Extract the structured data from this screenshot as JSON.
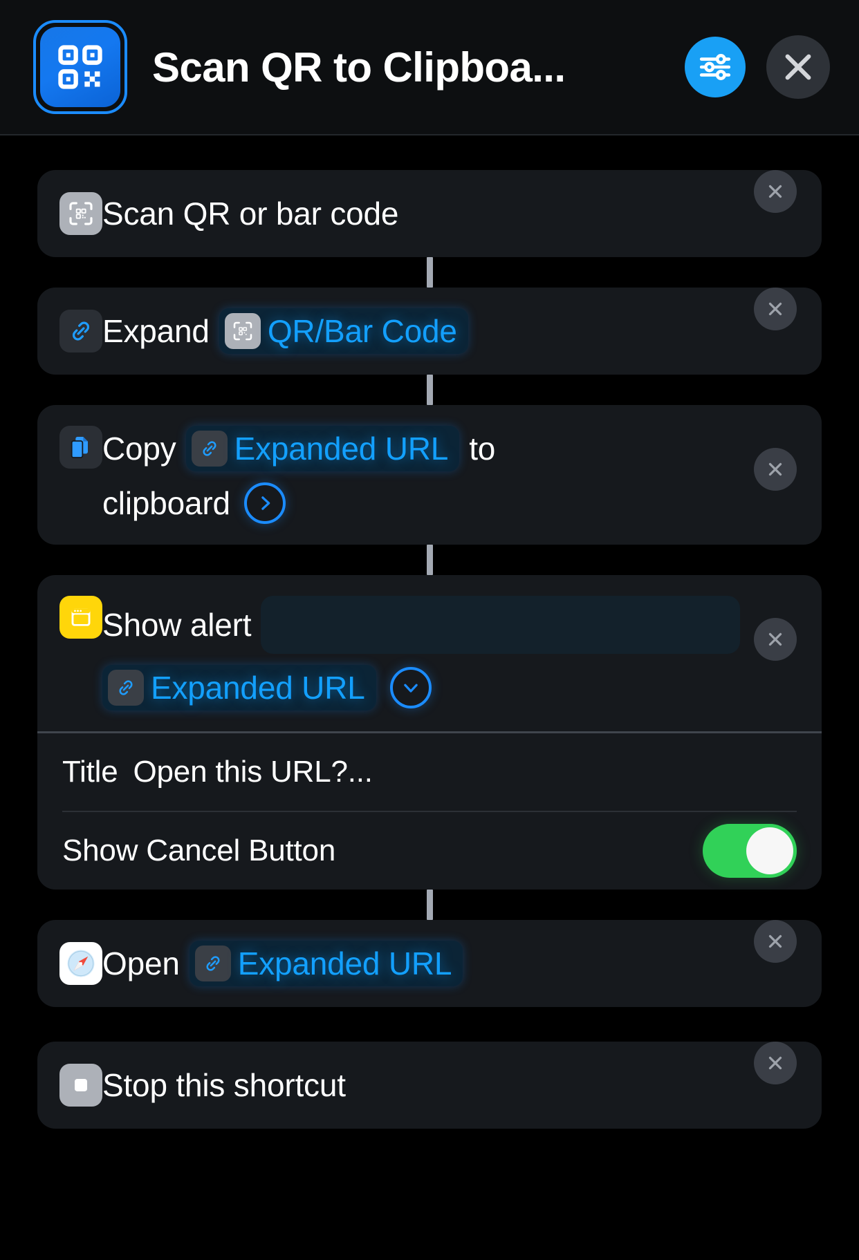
{
  "header": {
    "title": "Scan QR to Clipboa...",
    "app_icon": "qr-code-icon",
    "settings_icon": "sliders-icon",
    "close_icon": "close-icon",
    "accent_blue": "#19a0f5",
    "icon_bg": "#1478f0"
  },
  "colors": {
    "background": "#000000",
    "card": "#16191d",
    "token_text": "#13a0ff",
    "token_bg": "#0b2436",
    "toggle_on": "#31d158",
    "alert_yellow": "#ffd60a",
    "connector": "#a3a9b3"
  },
  "actions": [
    {
      "id": "scan-qr-or-bar-code",
      "icon": "qr-scan-icon",
      "text": "Scan QR or bar code",
      "delete_label": "×"
    },
    {
      "id": "expand-url",
      "icon": "link-icon",
      "text": "Expand",
      "token": {
        "label": "QR/Bar Code",
        "icon": "qr-scan-icon"
      },
      "delete_label": "×"
    },
    {
      "id": "copy-to-clipboard",
      "icon": "copy-documents-icon",
      "text_before": "Copy",
      "token": {
        "label": "Expanded URL",
        "icon": "link-icon"
      },
      "text_after": "to",
      "text_line2": "clipboard",
      "chevron": "chevron-right-icon",
      "delete_label": "×"
    },
    {
      "id": "show-alert",
      "icon": "alert-window-icon",
      "text": "Show alert",
      "field_value": "",
      "field_placeholder": "",
      "token": {
        "label": "Expanded URL",
        "icon": "link-icon"
      },
      "chevron": "chevron-down-icon",
      "delete_label": "×",
      "params": [
        {
          "label": "Title",
          "value": "Open this URL?...",
          "type": "text"
        },
        {
          "label": "Show Cancel Button",
          "value": "on",
          "type": "toggle"
        }
      ]
    },
    {
      "id": "open-url",
      "icon": "safari-compass-icon",
      "text": "Open",
      "token": {
        "label": "Expanded URL",
        "icon": "link-icon"
      },
      "delete_label": "×"
    },
    {
      "id": "stop-this-shortcut",
      "icon": "stop-square-icon",
      "text": "Stop this shortcut",
      "delete_label": "×"
    }
  ]
}
